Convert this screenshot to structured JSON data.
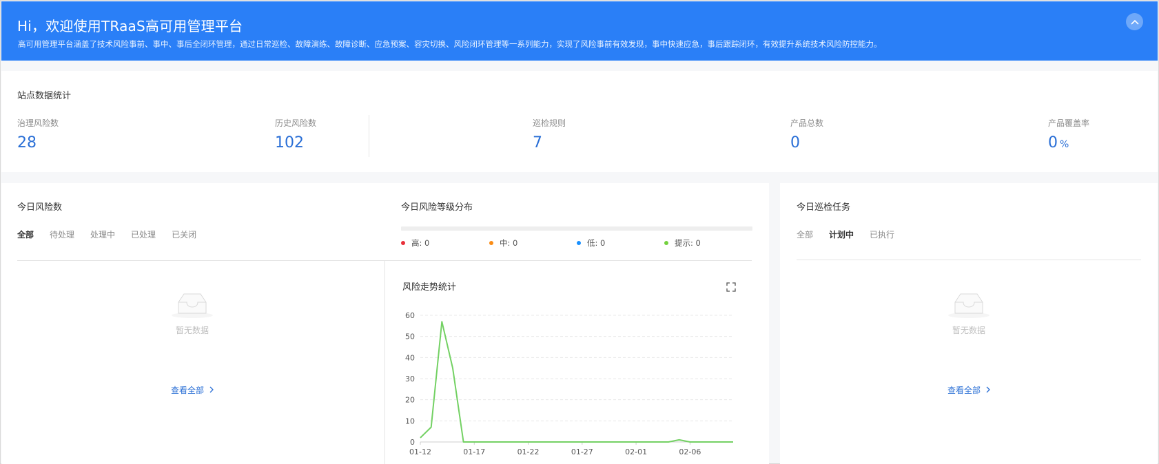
{
  "banner": {
    "title": "Hi，欢迎使用TRaaS高可用管理平台",
    "description": "高可用管理平台涵盖了技术风险事前、事中、事后全闭环管理，通过日常巡检、故障演练、故障诊断、应急预案、容灾切换、风险闭环管理等一系列能力，实现了风险事前有效发现，事中快速应急，事后跟踪闭环，有效提升系统技术风险防控能力。",
    "collapse_icon": "chevron-up-icon"
  },
  "stats": {
    "title": "站点数据统计",
    "items": [
      {
        "label": "治理风险数",
        "value": "28",
        "unit": ""
      },
      {
        "label": "历史风险数",
        "value": "102",
        "unit": ""
      },
      {
        "label": "巡检规则",
        "value": "7",
        "unit": ""
      },
      {
        "label": "产品总数",
        "value": "0",
        "unit": ""
      },
      {
        "label": "产品覆盖率",
        "value": "0",
        "unit": "%"
      }
    ]
  },
  "today_risk": {
    "title": "今日风险数",
    "tabs": [
      "全部",
      "待处理",
      "处理中",
      "已处理",
      "已关闭"
    ],
    "active_tab": 0,
    "empty_text": "暂无数据",
    "view_all": "查看全部"
  },
  "risk_level": {
    "title": "今日风险等级分布",
    "legend": [
      {
        "label": "高: 0",
        "color": "#e8303a"
      },
      {
        "label": "中: 0",
        "color": "#fa8c16"
      },
      {
        "label": "低: 0",
        "color": "#1890ff"
      },
      {
        "label": "提示: 0",
        "color": "#73d13d"
      }
    ]
  },
  "trend": {
    "title": "风险走势统计",
    "expand_icon": "fullscreen-icon"
  },
  "inspection": {
    "title": "今日巡检任务",
    "tabs": [
      "全部",
      "计划中",
      "已执行"
    ],
    "active_tab": 1,
    "empty_text": "暂无数据",
    "view_all": "查看全部"
  },
  "colors": {
    "banner": "#2a7ff7",
    "accent": "#2a6fd6",
    "line": "#73d163"
  },
  "chart_data": {
    "type": "line",
    "title": "风险走势统计",
    "xlabel": "",
    "ylabel": "",
    "ylim": [
      0,
      60
    ],
    "yticks": [
      0,
      10,
      20,
      30,
      40,
      50,
      60
    ],
    "xlim": [
      "01-12",
      "02-10"
    ],
    "x_tick_labels": [
      "01-12",
      "01-17",
      "01-22",
      "01-27",
      "02-01",
      "02-06"
    ],
    "grid": true,
    "x": [
      "01-12",
      "01-13",
      "01-14",
      "01-15",
      "01-16",
      "01-17",
      "01-18",
      "01-19",
      "01-20",
      "01-21",
      "01-22",
      "01-23",
      "01-24",
      "01-25",
      "01-26",
      "01-27",
      "01-28",
      "01-29",
      "01-30",
      "01-31",
      "02-01",
      "02-02",
      "02-03",
      "02-04",
      "02-05",
      "02-06",
      "02-07",
      "02-08",
      "02-09",
      "02-10"
    ],
    "series": [
      {
        "values": [
          2,
          7,
          57,
          35,
          0,
          0,
          0,
          0,
          0,
          0,
          0,
          0,
          0,
          0,
          0,
          0,
          0,
          0,
          0,
          0,
          0,
          0,
          0,
          0,
          1,
          0,
          0,
          0,
          0,
          0
        ]
      }
    ]
  }
}
